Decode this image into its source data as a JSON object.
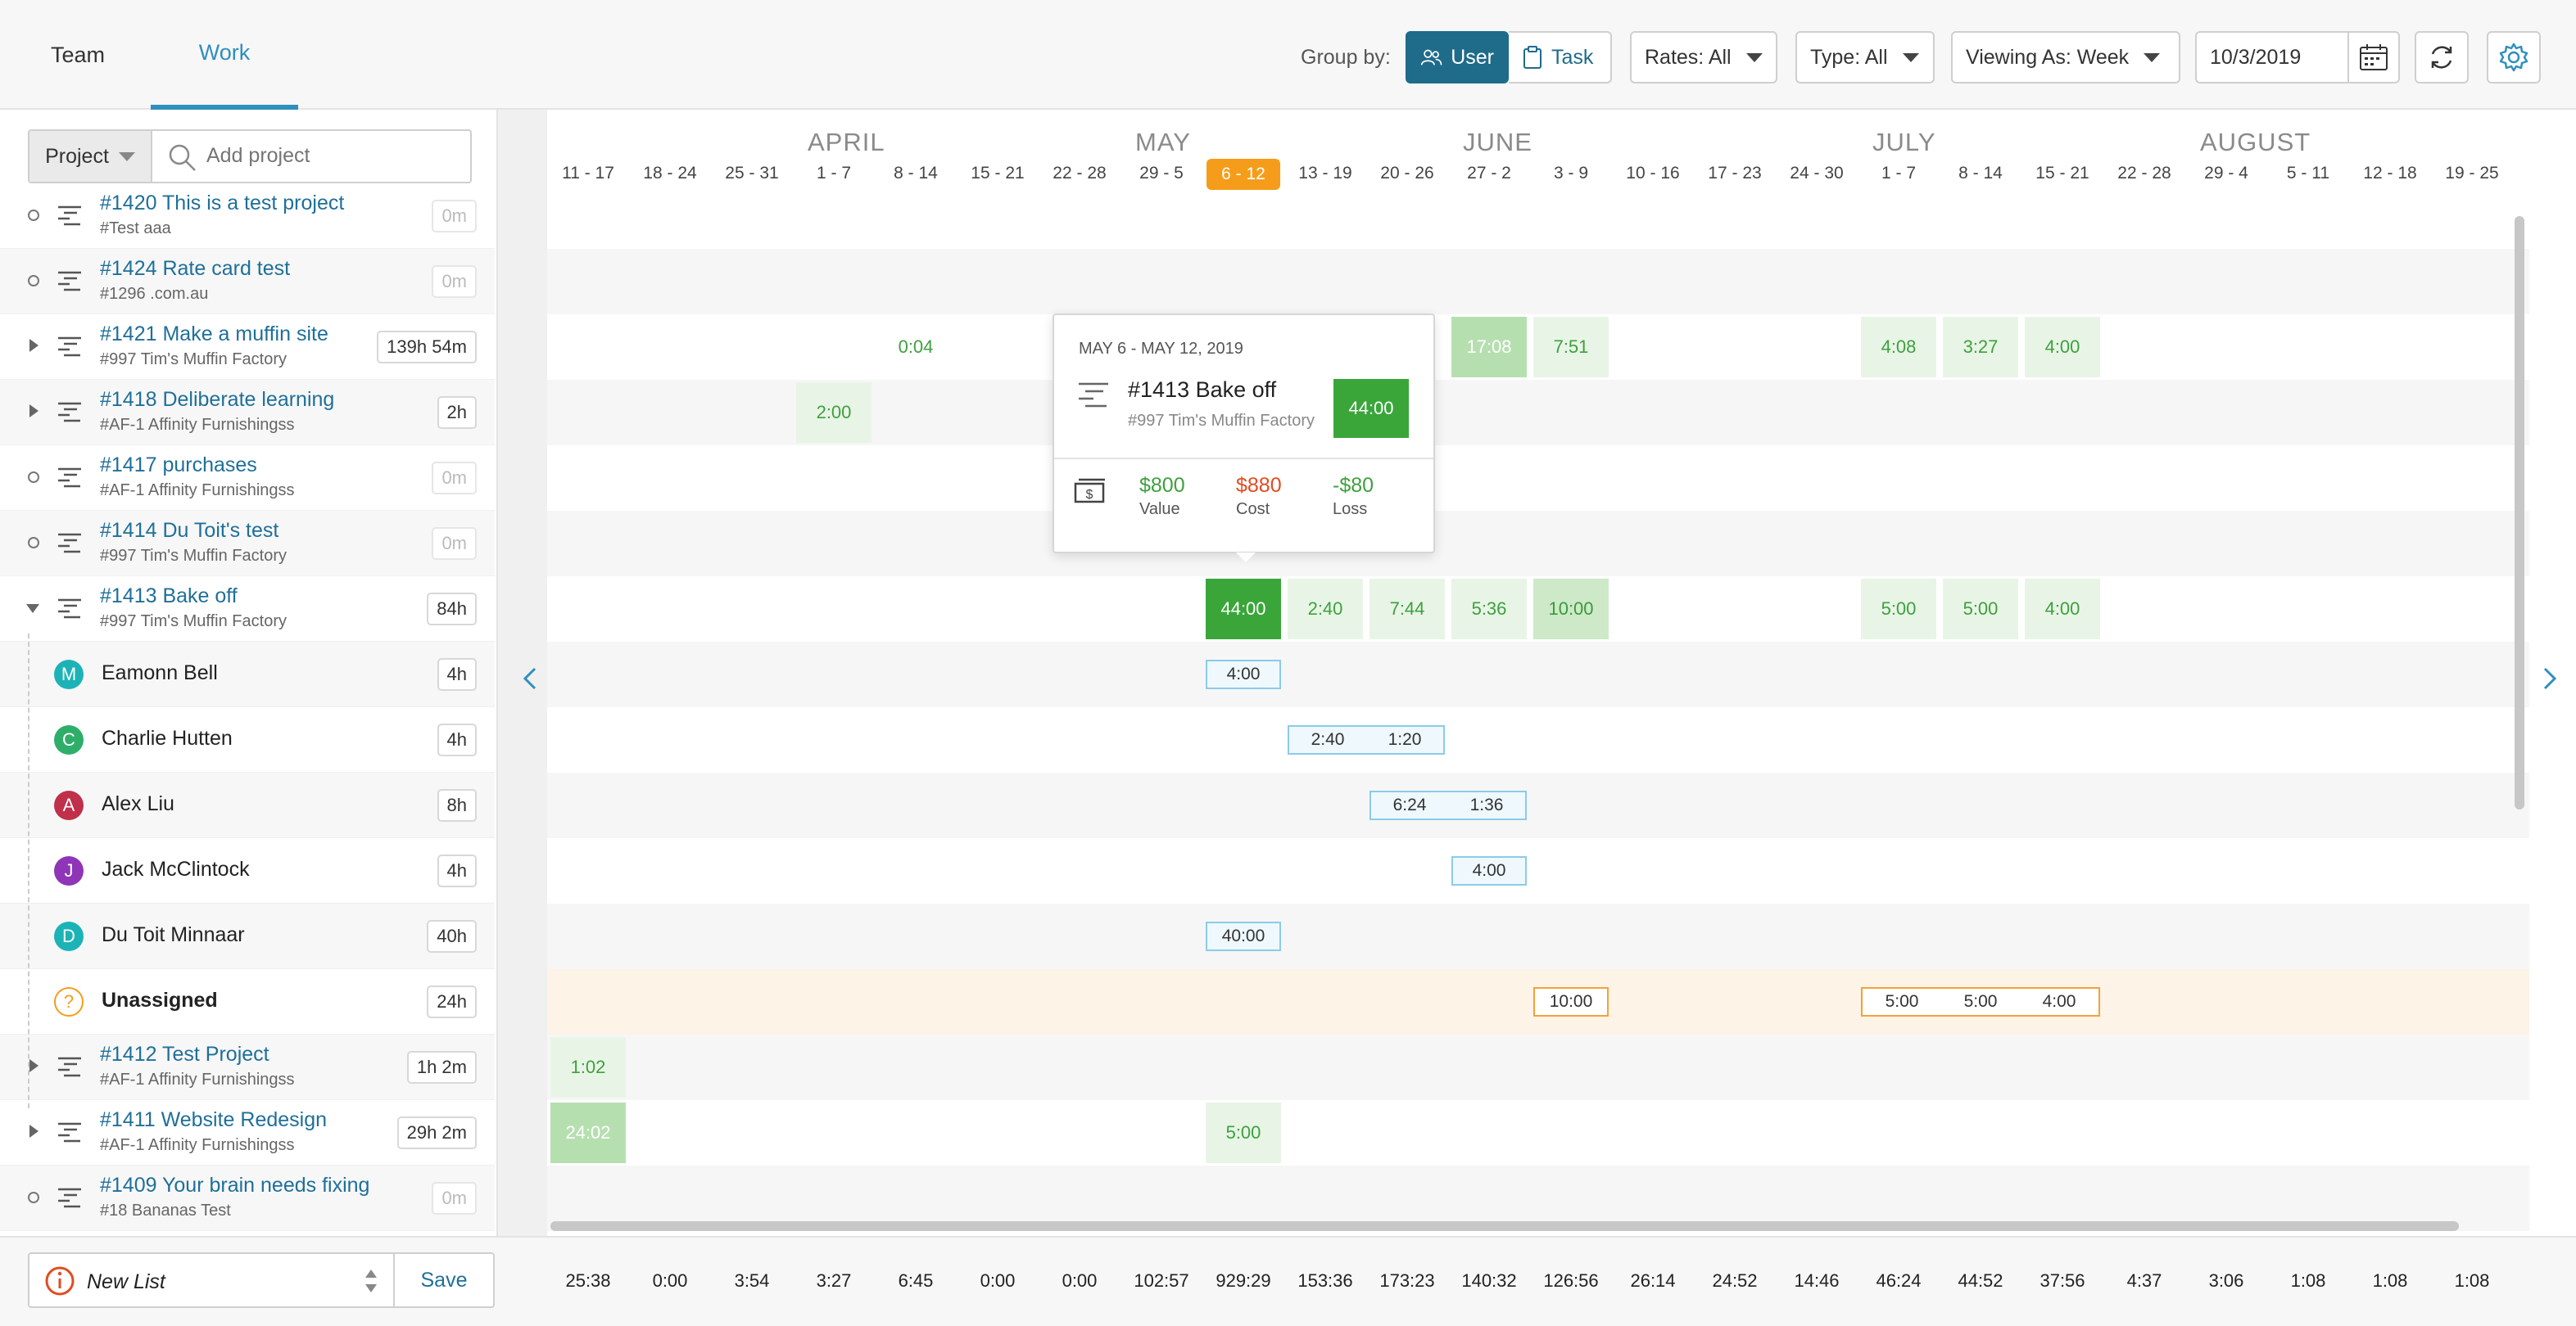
{
  "tabs": [
    {
      "label": "Team",
      "active": false
    },
    {
      "label": "Work",
      "active": true
    }
  ],
  "header": {
    "group_by_label": "Group by:",
    "group_user": "User",
    "group_task": "Task",
    "rates": "Rates: All",
    "type": "Type: All",
    "viewing_as": "Viewing As: Week",
    "date": "10/3/2019",
    "icons": [
      "users-icon",
      "clipboard-icon",
      "calendar-icon",
      "refresh-icon",
      "gear-icon"
    ]
  },
  "filter": {
    "dropdown": "Project",
    "placeholder": "Add project"
  },
  "rows": [
    {
      "kind": "project",
      "expander": "circle",
      "title": "#1420 This is a test project",
      "sub": "#Test aaa",
      "hours": "0m",
      "muted": true
    },
    {
      "kind": "project",
      "expander": "circle",
      "title": "#1424 Rate card test",
      "sub": "#1296 .com.au",
      "hours": "0m",
      "muted": true
    },
    {
      "kind": "project",
      "expander": "right",
      "title": "#1421 Make a muffin site",
      "sub": "#997 Tim's Muffin Factory",
      "hours": "139h 54m",
      "muted": false
    },
    {
      "kind": "project",
      "expander": "right",
      "title": "#1418 Deliberate learning",
      "sub": "#AF-1 Affinity Furnishingss",
      "hours": "2h",
      "muted": false
    },
    {
      "kind": "project",
      "expander": "circle",
      "title": "#1417 purchases",
      "sub": "#AF-1 Affinity Furnishingss",
      "hours": "0m",
      "muted": true
    },
    {
      "kind": "project",
      "expander": "circle",
      "title": "#1414 Du Toit's test",
      "sub": "#997 Tim's Muffin Factory",
      "hours": "0m",
      "muted": true
    },
    {
      "kind": "project",
      "expander": "down",
      "title": "#1413 Bake off",
      "sub": "#997 Tim's Muffin Factory",
      "hours": "84h",
      "muted": false
    },
    {
      "kind": "user",
      "initial": "M",
      "color": "#1cb3b7",
      "name": "Eamonn Bell",
      "hours": "4h"
    },
    {
      "kind": "user",
      "initial": "C",
      "color": "#2fae6a",
      "name": "Charlie Hutten",
      "hours": "4h"
    },
    {
      "kind": "user",
      "initial": "A",
      "color": "#c0304a",
      "name": "Alex Liu",
      "hours": "8h"
    },
    {
      "kind": "user",
      "initial": "J",
      "color": "#8e35b8",
      "name": "Jack McClintock",
      "hours": "4h"
    },
    {
      "kind": "user",
      "initial": "D",
      "color": "#1cb3b7",
      "name": "Du Toit Minnaar",
      "hours": "40h"
    },
    {
      "kind": "unassigned",
      "initial": "?",
      "color": "#f59d1a",
      "name": "Unassigned",
      "hours": "24h"
    },
    {
      "kind": "project",
      "expander": "right",
      "title": "#1412 Test Project",
      "sub": "#AF-1 Affinity Furnishingss",
      "hours": "1h 2m",
      "muted": false
    },
    {
      "kind": "project",
      "expander": "right",
      "title": "#1411 Website Redesign",
      "sub": "#AF-1 Affinity Furnishingss",
      "hours": "29h 2m",
      "muted": false
    },
    {
      "kind": "project",
      "expander": "circle",
      "title": "#1409 Your brain needs fixing",
      "sub": "#18 Bananas Test",
      "hours": "0m",
      "muted": true
    }
  ],
  "months": [
    {
      "label": "APRIL",
      "week_index": 3
    },
    {
      "label": "MAY",
      "week_index": 7
    },
    {
      "label": "JUNE",
      "week_index": 11
    },
    {
      "label": "JULY",
      "week_index": 16
    },
    {
      "label": "AUGUST",
      "week_index": 20
    }
  ],
  "weeks": [
    "11 - 17",
    "18 - 24",
    "25 - 31",
    "1 - 7",
    "8 - 14",
    "15 - 21",
    "22 - 28",
    "29 - 5",
    "6 - 12",
    "13 - 19",
    "20 - 26",
    "27 - 2",
    "3 - 9",
    "10 - 16",
    "17 - 23",
    "24 - 30",
    "1 - 7",
    "8 - 14",
    "15 - 21",
    "22 - 28",
    "29 - 4",
    "5 - 11",
    "12 - 18",
    "19 - 25"
  ],
  "current_week_index": 8,
  "cells": [
    {
      "row": 2,
      "week": 4,
      "value": "0:04",
      "style": "text"
    },
    {
      "row": 2,
      "week": 11,
      "value": "17:08",
      "style": "dark"
    },
    {
      "row": 2,
      "week": 12,
      "value": "7:51",
      "style": "light"
    },
    {
      "row": 2,
      "week": 16,
      "value": "4:08",
      "style": "light"
    },
    {
      "row": 2,
      "week": 17,
      "value": "3:27",
      "style": "light"
    },
    {
      "row": 2,
      "week": 18,
      "value": "4:00",
      "style": "light"
    },
    {
      "row": 3,
      "week": 3,
      "value": "2:00",
      "style": "light"
    },
    {
      "row": 6,
      "week": 8,
      "value": "44:00",
      "style": "solid"
    },
    {
      "row": 6,
      "week": 9,
      "value": "2:40",
      "style": "light"
    },
    {
      "row": 6,
      "week": 10,
      "value": "7:44",
      "style": "light"
    },
    {
      "row": 6,
      "week": 11,
      "value": "5:36",
      "style": "light"
    },
    {
      "row": 6,
      "week": 12,
      "value": "10:00",
      "style": "mid"
    },
    {
      "row": 6,
      "week": 16,
      "value": "5:00",
      "style": "light"
    },
    {
      "row": 6,
      "week": 17,
      "value": "5:00",
      "style": "light"
    },
    {
      "row": 6,
      "week": 18,
      "value": "4:00",
      "style": "light"
    },
    {
      "row": 13,
      "week": 0,
      "value": "1:02",
      "style": "light"
    },
    {
      "row": 14,
      "week": 0,
      "value": "24:02",
      "style": "dark"
    },
    {
      "row": 14,
      "week": 8,
      "value": "5:00",
      "style": "light"
    }
  ],
  "boxes": [
    {
      "row": 7,
      "start": 8,
      "color": "blue",
      "values": [
        "4:00"
      ]
    },
    {
      "row": 8,
      "start": 9,
      "color": "blue",
      "values": [
        "2:40",
        "1:20"
      ]
    },
    {
      "row": 9,
      "start": 10,
      "color": "blue",
      "values": [
        "6:24",
        "1:36"
      ]
    },
    {
      "row": 10,
      "start": 11,
      "color": "blue",
      "values": [
        "4:00"
      ]
    },
    {
      "row": 11,
      "start": 8,
      "color": "blue",
      "values": [
        "40:00"
      ]
    },
    {
      "row": 12,
      "start": 12,
      "color": "orange",
      "values": [
        "10:00"
      ]
    },
    {
      "row": 12,
      "start": 16,
      "color": "orange",
      "values": [
        "5:00",
        "5:00",
        "4:00"
      ]
    }
  ],
  "tooltip": {
    "date_range": "MAY 6 - MAY 12, 2019",
    "title": "#1413 Bake off",
    "sub": "#997 Tim's Muffin Factory",
    "hours": "44:00",
    "value": "$800",
    "value_label": "Value",
    "cost": "$880",
    "cost_label": "Cost",
    "loss": "-$80",
    "loss_label": "Loss"
  },
  "footer": {
    "list_name": "New List",
    "save_label": "Save",
    "totals": [
      "25:38",
      "0:00",
      "3:54",
      "3:27",
      "6:45",
      "0:00",
      "0:00",
      "102:57",
      "929:29",
      "153:36",
      "173:23",
      "140:32",
      "126:56",
      "26:14",
      "24:52",
      "14:46",
      "46:24",
      "44:52",
      "37:56",
      "4:37",
      "3:06",
      "1:08",
      "1:08",
      "1:08"
    ]
  },
  "colors": {
    "accent": "#2f8fbd",
    "active_button": "#1f6b8a",
    "current_week": "#f59d1a",
    "green": "#3aa63a",
    "cost_red": "#e24c1f"
  }
}
